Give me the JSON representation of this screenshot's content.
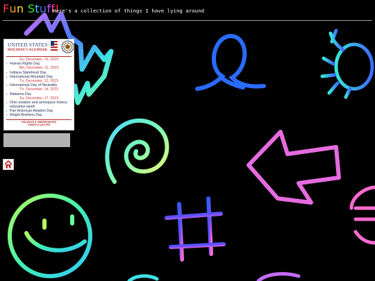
{
  "header": {
    "title_letters": [
      "F",
      "u",
      "n",
      " ",
      "S",
      "t",
      "u",
      "f",
      "f",
      "!"
    ],
    "title_colors": [
      "#ff3b3b",
      "#ff9a1f",
      "#ffe432",
      "#000000",
      "#3fe33f",
      "#2ad8ff",
      "#5b6bff",
      "#c25bff",
      "#ff3b8d",
      "#ff3b3b"
    ],
    "subtitle": "Here's a collection of things I have lying around"
  },
  "calendar": {
    "country": "UNITED STATES",
    "heading": "HOLIDAY CALENDAR",
    "entries": [
      {
        "date": "Su, December, 10, 2023",
        "events": [
          "Human Rights Day"
        ]
      },
      {
        "date": "Mo, December, 11, 2023",
        "events": [
          "Indiana Statehood Day",
          "International Mountain Day"
        ]
      },
      {
        "date": "Tu, December, 12, 2023",
        "events": [
          "International Day of Neutrality"
        ]
      },
      {
        "date": "Th, December, 14, 2023",
        "events": [
          "Alabama Day"
        ]
      },
      {
        "date": "Su, December, 17, 2023",
        "events": [
          "Ohio aviation and aerospace history education week",
          "Pan American Aviation Day",
          "Wright Brothers Day"
        ]
      }
    ],
    "footer_line1": "HOLIDAYS & OBSERVANCES",
    "footer_line2": "CARDS & QUOTES"
  },
  "home_button": {
    "icon": "home-icon"
  }
}
